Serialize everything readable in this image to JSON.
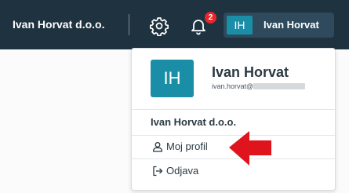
{
  "header": {
    "company": "Ivan Horvat d.o.o.",
    "notification_count": "2",
    "user_initials": "IH",
    "user_name": "Ivan Horvat"
  },
  "menu": {
    "avatar_initials": "IH",
    "full_name": "Ivan Horvat",
    "email_visible": "ivan.horvat@",
    "organization": "Ivan Horvat d.o.o.",
    "items": [
      {
        "label": "Moj profil",
        "icon": "user-icon"
      },
      {
        "label": "Odjava",
        "icon": "logout-icon"
      }
    ]
  },
  "colors": {
    "topbar": "#1f3240",
    "accent": "#1a8ea6",
    "badge": "#e8262b",
    "annotation_arrow": "#e0141c"
  }
}
